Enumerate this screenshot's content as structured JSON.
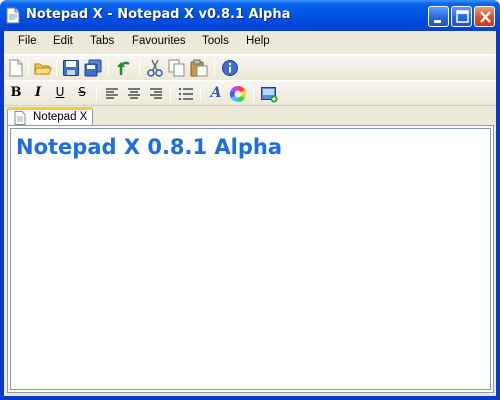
{
  "window": {
    "title": "Notepad X - Notepad X v0.8.1 Alpha"
  },
  "menu": [
    "File",
    "Edit",
    "Tabs",
    "Favourites",
    "Tools",
    "Help"
  ],
  "toolbar_main": [
    "new-document",
    "open-folder",
    "save",
    "save-all",
    "undo",
    "cut",
    "copy",
    "paste",
    "about-info"
  ],
  "toolbar_format": {
    "bold_label": "B",
    "italic_label": "I",
    "underline_label": "U",
    "strike_label": "S",
    "font_label": "A",
    "icons": [
      "bold",
      "italic",
      "underline",
      "strikethrough",
      "align-left",
      "align-center",
      "align-right",
      "bullet-list",
      "font",
      "color-picker",
      "insert-image"
    ]
  },
  "tabs": [
    {
      "label": "Notepad X",
      "active": true
    }
  ],
  "editor": {
    "content": "Notepad X 0.8.1 Alpha",
    "text_color": "#1f6ee0"
  },
  "colors": {
    "titlebar": "#0055e5",
    "chrome": "#ece9d8",
    "tab_accent": "#ffc83c"
  }
}
